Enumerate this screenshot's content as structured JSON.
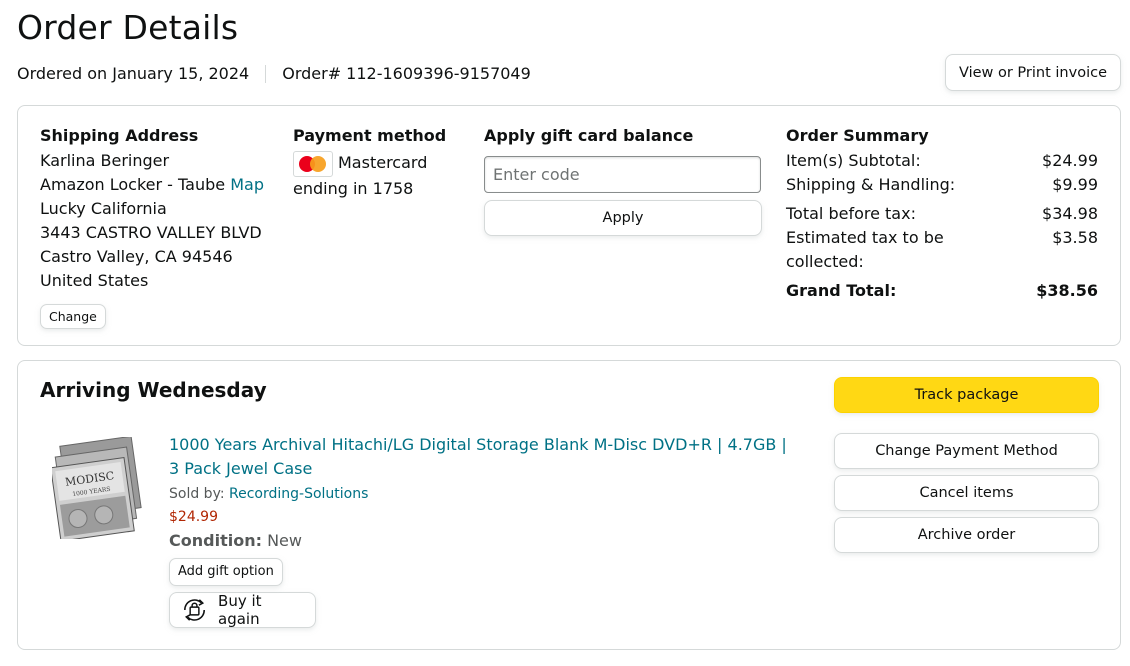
{
  "header": {
    "title": "Order Details",
    "ordered_on": "Ordered on January 15, 2024",
    "order_number": "Order# 112-1609396-9157049",
    "invoice_label": "View or Print invoice"
  },
  "shipping": {
    "title": "Shipping Address",
    "name": "Karlina Beringer",
    "locker": "Amazon Locker - Taube",
    "map_link": "Map",
    "line2": "Lucky California",
    "street": "3443 CASTRO VALLEY BLVD",
    "city": "Castro Valley, CA 94546",
    "country": "United States",
    "change_label": "Change"
  },
  "payment": {
    "title": "Payment method",
    "card_brand": "Mastercard",
    "card_ending": "ending in 1758",
    "card_icon": "mastercard-icon"
  },
  "gift_card": {
    "title": "Apply gift card balance",
    "placeholder": "Enter code",
    "apply_label": "Apply"
  },
  "summary": {
    "title": "Order Summary",
    "rows": [
      {
        "label": "Item(s) Subtotal:",
        "value": "$24.99"
      },
      {
        "label": "Shipping & Handling:",
        "value": "$9.99"
      },
      {
        "label": "Total before tax:",
        "value": "$34.98"
      },
      {
        "label": "Estimated tax to be collected:",
        "value": "$3.58"
      }
    ],
    "grand_label": "Grand Total:",
    "grand_value": "$38.56"
  },
  "shipment": {
    "arrival": "Arriving Wednesday",
    "product": {
      "title": "1000 Years Archival Hitachi/LG Digital Storage Blank M-Disc DVD+R | 4.7GB | 3 Pack Jewel Case",
      "sold_by_label": "Sold by: ",
      "seller": "Recording-Solutions",
      "price": "$24.99",
      "condition_label": "Condition:",
      "condition_value": "New",
      "gift_option_label": "Add gift option",
      "buy_again_label": "Buy it again",
      "image_text_top": "MODISC",
      "image_text_bottom": "1000 YEARS"
    },
    "actions": {
      "track": "Track package",
      "change_payment": "Change Payment Method",
      "cancel": "Cancel items",
      "archive": "Archive order"
    }
  },
  "colors": {
    "link": "#007185",
    "price": "#b12704",
    "primary_button": "#ffd814",
    "border": "#d5d9d9"
  }
}
